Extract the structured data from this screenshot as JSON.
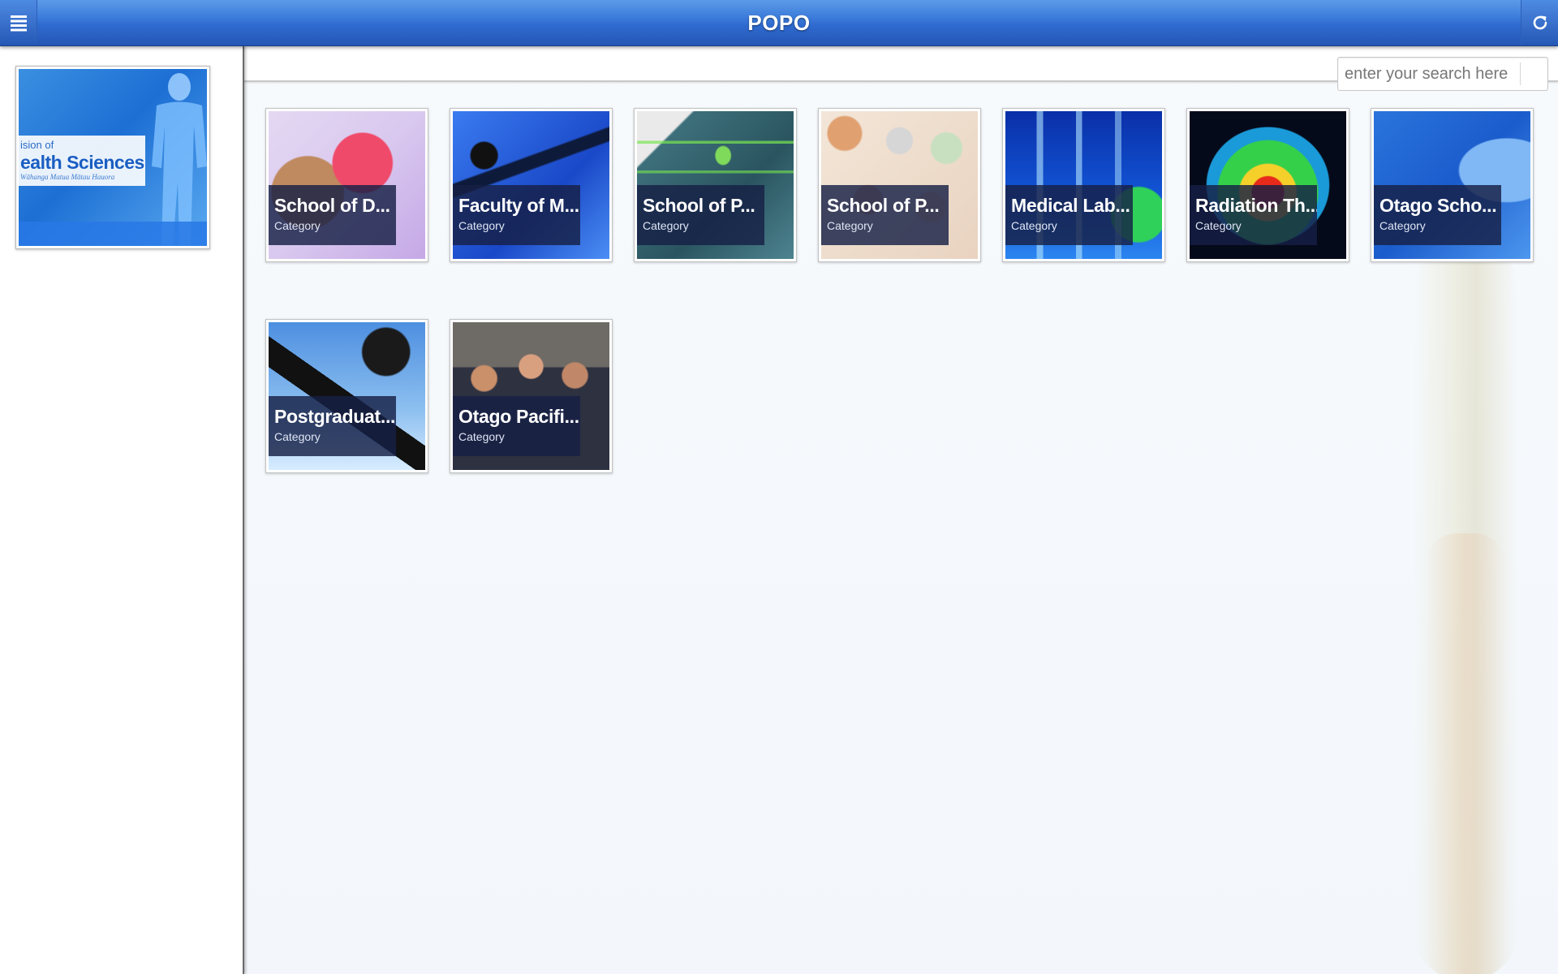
{
  "header": {
    "title": "POPO",
    "menu_icon": "hamburger-menu-icon",
    "refresh_icon": "refresh-icon"
  },
  "sidebar": {
    "thumbnail": {
      "line1": "ision of",
      "line2": "ealth Sciences",
      "line3": "Wāhanga Matua Mātau Hauora"
    }
  },
  "search": {
    "placeholder": "enter your search here",
    "value": ""
  },
  "tiles": [
    {
      "title": "School of D...",
      "subtitle": "Category"
    },
    {
      "title": "Faculty of M...",
      "subtitle": "Category"
    },
    {
      "title": "School of P...",
      "subtitle": "Category"
    },
    {
      "title": "School of P...",
      "subtitle": "Category"
    },
    {
      "title": "Medical Lab...",
      "subtitle": "Category"
    },
    {
      "title": "Radiation Th...",
      "subtitle": "Category"
    },
    {
      "title": "Otago Scho...",
      "subtitle": "Category"
    },
    {
      "title": "Postgraduat...",
      "subtitle": "Category"
    },
    {
      "title": "Otago Pacifi...",
      "subtitle": "Category"
    }
  ],
  "colors": {
    "header": "#2f6bd0",
    "caption_bg": "#162046",
    "sidebar_border": "#6a6a6a"
  }
}
